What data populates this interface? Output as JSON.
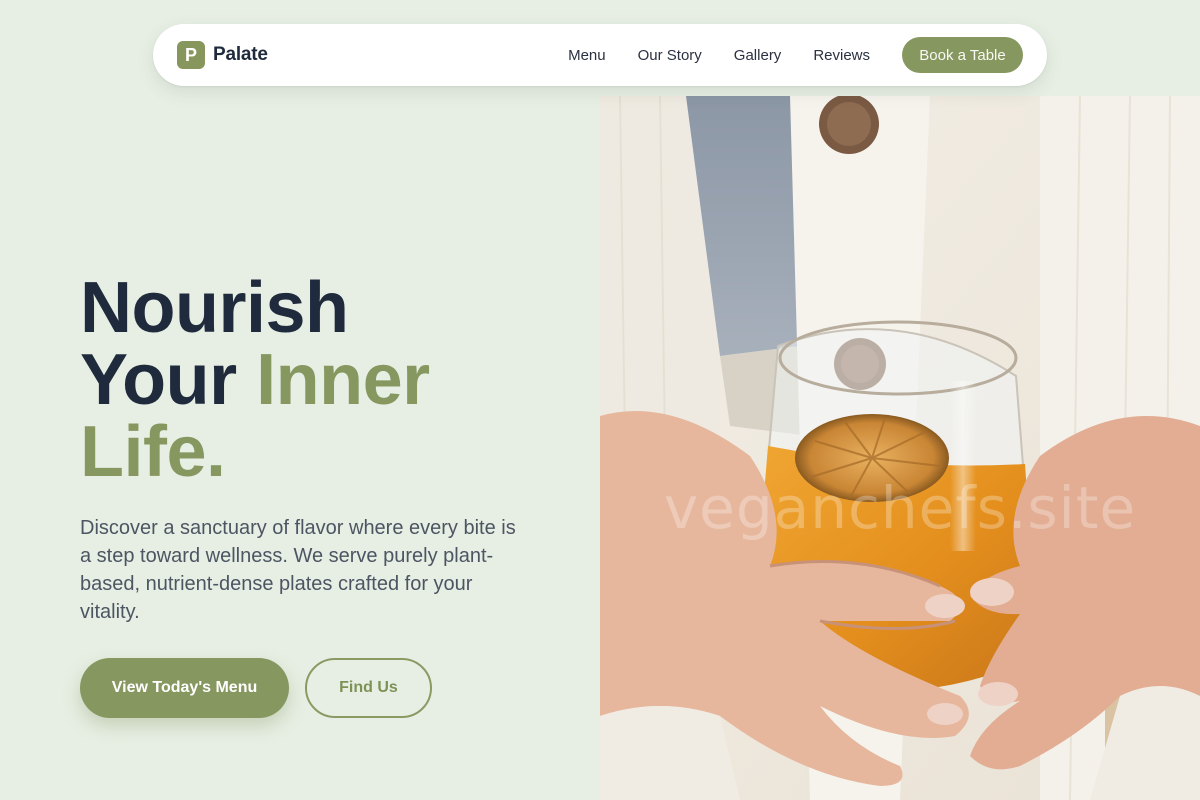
{
  "brand": {
    "mark": "P",
    "name": "Palate"
  },
  "nav": {
    "links": [
      "Menu",
      "Our Story",
      "Gallery",
      "Reviews"
    ],
    "cta": "Book a Table"
  },
  "hero": {
    "title_line1": "Nourish",
    "title_line2_plain": "Your ",
    "title_line2_accent": "Inner",
    "title_line3_accent": "Life.",
    "description": "Discover a sanctuary of flavor where every bite is a step toward wellness. We serve purely plant-based, nutrient-dense plates crafted for your vitality.",
    "primary_button": "View Today's Menu",
    "secondary_button": "Find Us"
  },
  "image": {
    "watermark": "veganchefs.site",
    "icon": "photo-hands-holding-glass-of-orange-drink"
  },
  "colors": {
    "background": "#e7efe4",
    "accent": "#879760",
    "heading": "#1f2a3d",
    "body_text": "#4d5563"
  }
}
